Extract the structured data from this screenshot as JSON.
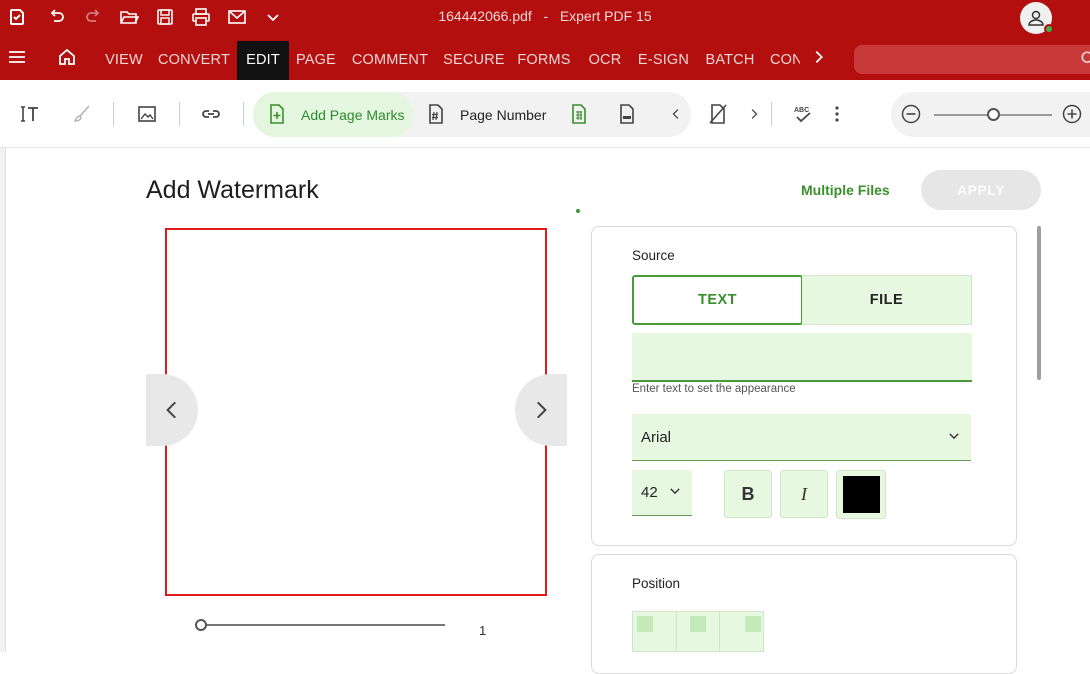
{
  "titlebar": {
    "filename": "164442066.pdf",
    "separator": "-",
    "app_name": "Expert PDF 15"
  },
  "menu": {
    "tabs": [
      "VIEW",
      "CONVERT",
      "EDIT",
      "PAGE",
      "COMMENT",
      "SECURE",
      "FORMS",
      "OCR",
      "E-SIGN",
      "BATCH",
      "CON"
    ],
    "active_tab": "EDIT"
  },
  "toolbar": {
    "add_page_marks_label": "Add Page Marks",
    "page_number_label": "Page Number"
  },
  "watermark": {
    "heading": "Add Watermark",
    "multiple_files_label": "Multiple Files",
    "apply_label": "APPLY",
    "preview": {
      "page_number": "1"
    },
    "source": {
      "heading": "Source",
      "text_tab": "TEXT",
      "file_tab": "FILE",
      "selected_tab": "TEXT",
      "text_value": "",
      "helper": "Enter text to set the appearance",
      "font": "Arial",
      "font_size": "42",
      "bold_label": "B",
      "italic_label": "I",
      "color": "#000000"
    },
    "position": {
      "heading": "Position"
    }
  },
  "colors": {
    "brand_red": "#b30f0f",
    "accent_green": "#3a8f2b",
    "field_green": "#e6f8e0",
    "preview_border": "#e01b1b"
  }
}
